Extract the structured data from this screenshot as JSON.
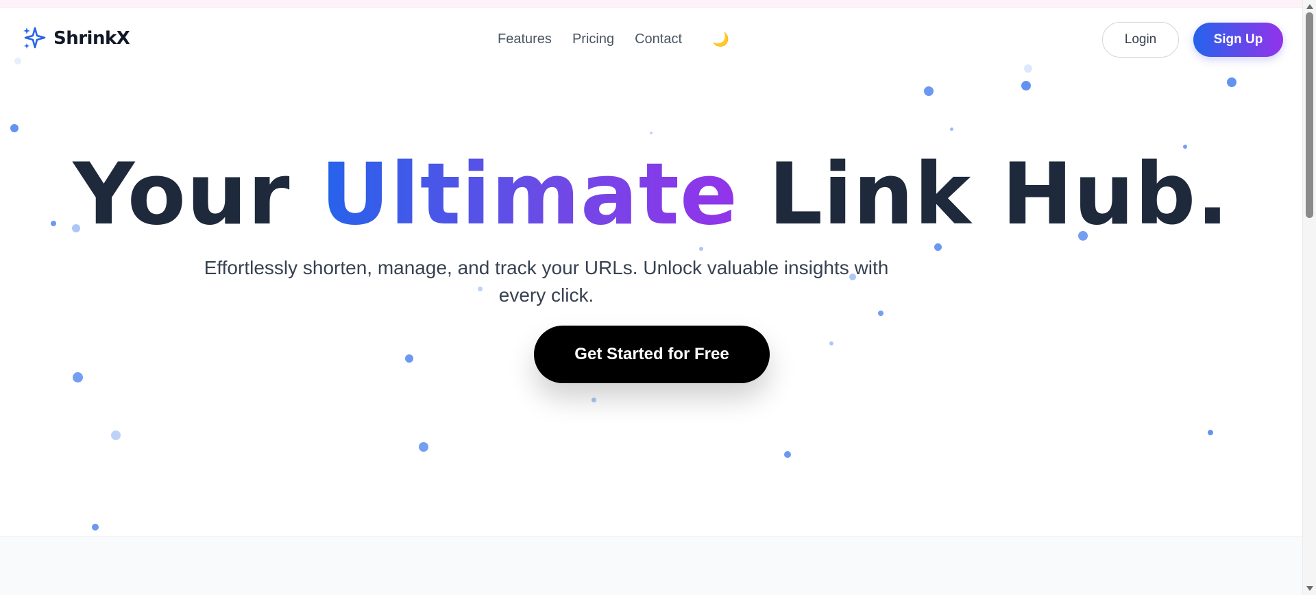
{
  "brand": {
    "name": "ShrinkX",
    "icon": "sparkles-icon",
    "icon_color": "#2563eb"
  },
  "nav": {
    "links": [
      "Features",
      "Pricing",
      "Contact"
    ],
    "theme_toggle": "🌙"
  },
  "auth": {
    "login_label": "Login",
    "signup_label": "Sign Up"
  },
  "hero": {
    "title_before": "Your",
    "title_highlight": "Ultimate",
    "title_after": "Link Hub.",
    "subtitle": "Effortlessly shorten, manage, and track your URLs. Unlock valuable insights with every click.",
    "cta_label": "Get Started for Free"
  },
  "colors": {
    "gradient_start": "#2563eb",
    "gradient_end": "#9333ea",
    "heading": "#1e293b",
    "cta_bg": "#000000",
    "particle": "#5b8def"
  }
}
